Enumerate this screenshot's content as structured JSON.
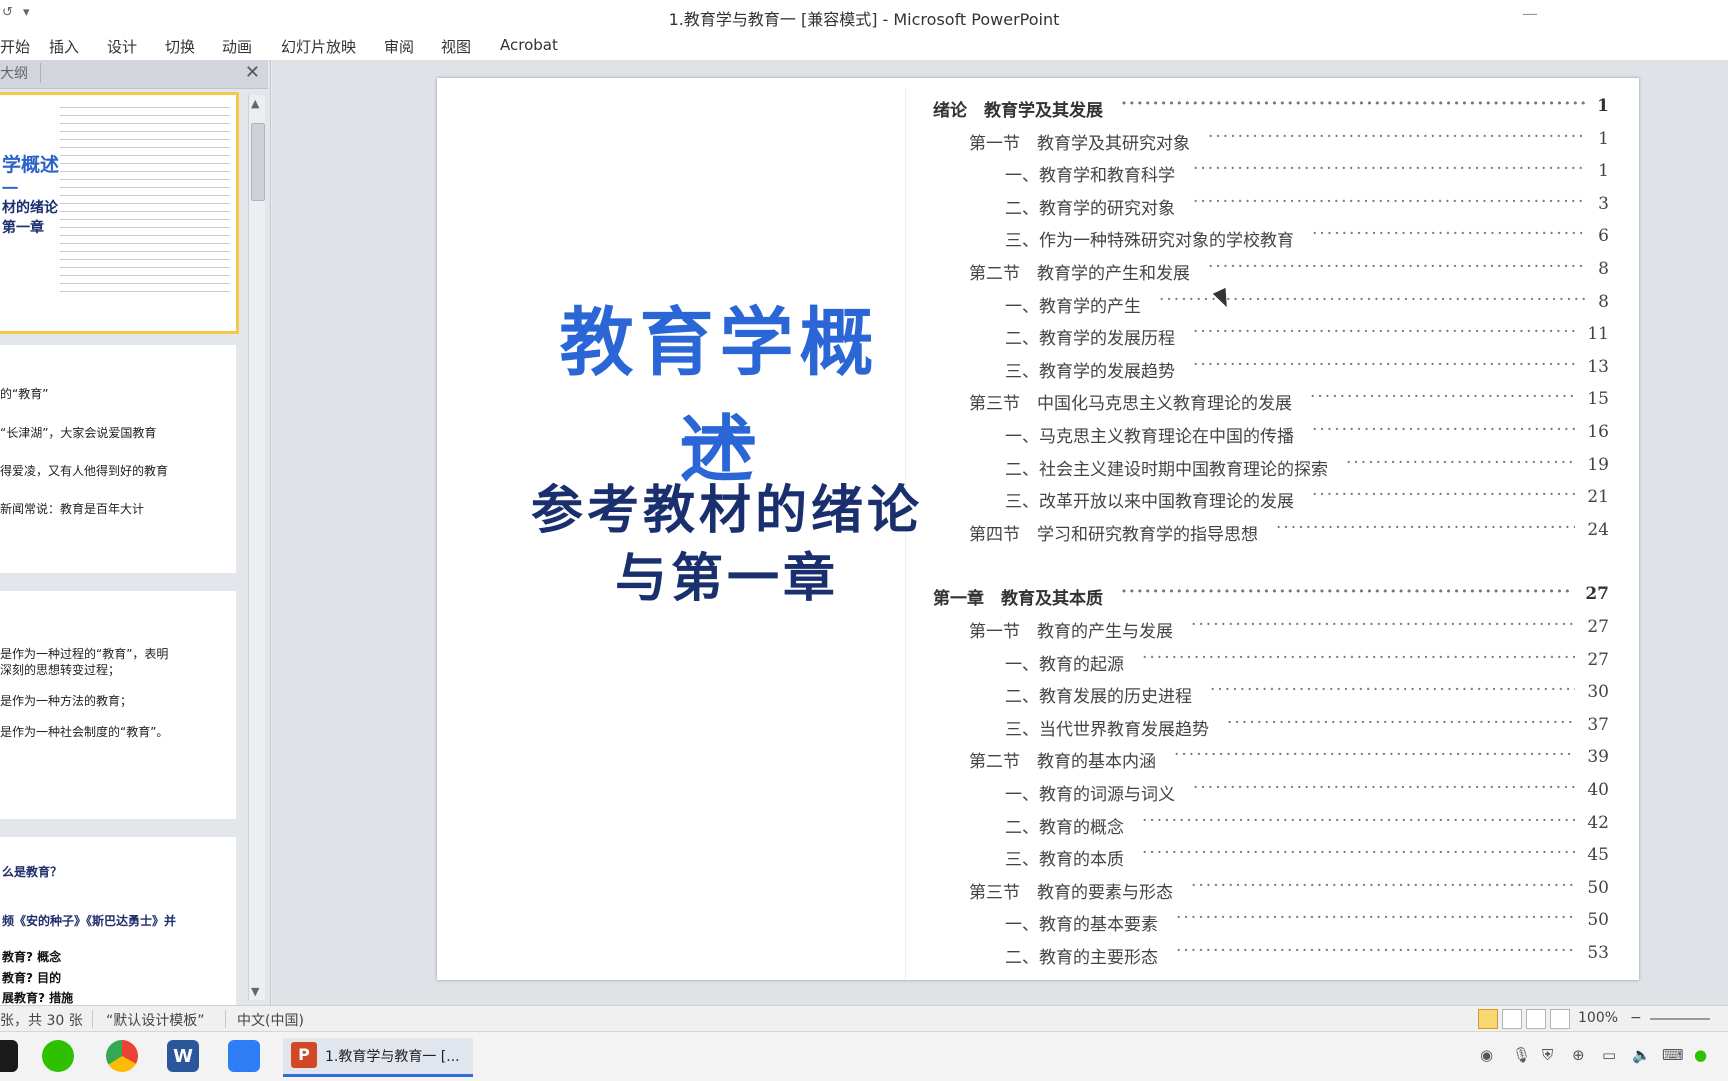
{
  "window": {
    "title": "1.教育学与教育一 [兼容模式] - Microsoft PowerPoint",
    "qat_undo": "↺",
    "qat_dropdown": "▾",
    "minimize": "—"
  },
  "ribbon": {
    "tabs": [
      "开始",
      "插入",
      "设计",
      "切换",
      "动画",
      "幻灯片放映",
      "审阅",
      "视图",
      "Acrobat"
    ]
  },
  "pane": {
    "tab_label": "大纲",
    "close": "✕"
  },
  "thumbs": {
    "t1": {
      "line1": "学概述",
      "line2": "一",
      "line3": "材的绪论",
      "line4": "第一章"
    },
    "t2": {
      "lines": [
        "的“教育”",
        "“长津湖”，大家会说爱国教育",
        "得爱凌，又有人他得到好的教育",
        "新闻常说：教育是百年大计"
      ]
    },
    "t3": {
      "lines": [
        "是作为一种过程的“教育”，表明",
        "深刻的思想转变过程；",
        "是作为一种方法的教育；",
        "是作为一种社会制度的“教育”。"
      ]
    },
    "t4": {
      "lines": [
        "么是教育？",
        "频《安的种子》《斯巴达勇士》并",
        "教育? 概念",
        "教育? 目的",
        "展教育? 措施"
      ]
    }
  },
  "slide": {
    "title_line1": "教育学概述",
    "title_line2": "一",
    "subtitle_line1": "参考教材的绪论",
    "subtitle_line2": "与第一章",
    "toc": [
      {
        "label": "绪论　教育学及其发展",
        "page": "1",
        "level": 0
      },
      {
        "label": "第一节　教育学及其研究对象",
        "page": "1",
        "level": 1
      },
      {
        "label": "一、教育学和教育科学",
        "page": "1",
        "level": 2
      },
      {
        "label": "二、教育学的研究对象",
        "page": "3",
        "level": 2
      },
      {
        "label": "三、作为一种特殊研究对象的学校教育",
        "page": "6",
        "level": 2
      },
      {
        "label": "第二节　教育学的产生和发展",
        "page": "8",
        "level": 1
      },
      {
        "label": "一、教育学的产生",
        "page": "8",
        "level": 2
      },
      {
        "label": "二、教育学的发展历程",
        "page": "11",
        "level": 2
      },
      {
        "label": "三、教育学的发展趋势",
        "page": "13",
        "level": 2
      },
      {
        "label": "第三节　中国化马克思主义教育理论的发展",
        "page": "15",
        "level": 1
      },
      {
        "label": "一、马克思主义教育理论在中国的传播",
        "page": "16",
        "level": 2
      },
      {
        "label": "二、社会主义建设时期中国教育理论的探索",
        "page": "19",
        "level": 2
      },
      {
        "label": "三、改革开放以来中国教育理论的发展",
        "page": "21",
        "level": 2
      },
      {
        "label": "第四节　学习和研究教育学的指导思想",
        "page": "24",
        "level": 1
      },
      {
        "label": "第一章　教育及其本质",
        "page": "27",
        "level": 0
      },
      {
        "label": "第一节　教育的产生与发展",
        "page": "27",
        "level": 1
      },
      {
        "label": "一、教育的起源",
        "page": "27",
        "level": 2
      },
      {
        "label": "二、教育发展的历史进程",
        "page": "30",
        "level": 2
      },
      {
        "label": "三、当代世界教育发展趋势",
        "page": "37",
        "level": 2
      },
      {
        "label": "第二节　教育的基本内涵",
        "page": "39",
        "level": 1
      },
      {
        "label": "一、教育的词源与词义",
        "page": "40",
        "level": 2
      },
      {
        "label": "二、教育的概念",
        "page": "42",
        "level": 2
      },
      {
        "label": "三、教育的本质",
        "page": "45",
        "level": 2
      },
      {
        "label": "第三节　教育的要素与形态",
        "page": "50",
        "level": 1
      },
      {
        "label": "一、教育的基本要素",
        "page": "50",
        "level": 2
      },
      {
        "label": "二、教育的主要形态",
        "page": "53",
        "level": 2
      }
    ]
  },
  "status": {
    "slide_count": "张，共 30 张",
    "theme": "“默认设计模板”",
    "language": "中文(中国)",
    "zoom": "100%",
    "zoom_minus": "−"
  },
  "taskbar": {
    "app_label": "1.教育学与教育一 [...",
    "word_letter": "W",
    "ppt_letter": "P"
  },
  "colors": {
    "title_blue": "#2a66d6",
    "subtitle_navy": "#1a2f6e",
    "selected_thumb": "#f2c94c"
  }
}
